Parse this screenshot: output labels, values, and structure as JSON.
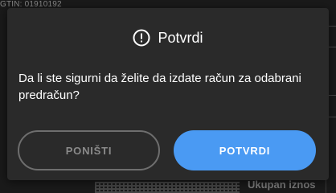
{
  "background": {
    "gtin_text": "GTIN: 01910192",
    "total_label": "Ukupan iznos"
  },
  "dialog": {
    "icon": "alert-circle-icon",
    "title": "Potvrdi",
    "message": "Da li ste sigurni da želite da izdate račun za odabrani predračun?",
    "cancel_label": "PONIŠTI",
    "confirm_label": "POTVRDI"
  },
  "colors": {
    "dialog_bg": "#2a2a2a",
    "confirm_bg": "#4a9af3",
    "cancel_border": "#6e6e6e",
    "cancel_text": "#8a8a8a"
  }
}
